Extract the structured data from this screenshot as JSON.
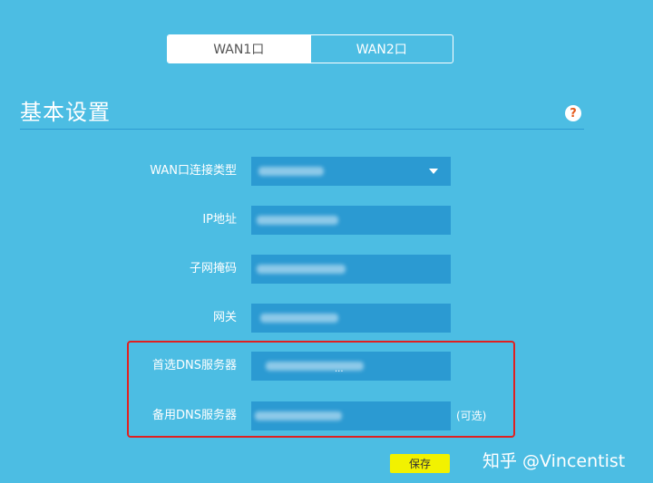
{
  "tabs": [
    {
      "label": "WAN1口",
      "active": true
    },
    {
      "label": "WAN2口",
      "active": false
    }
  ],
  "section": {
    "title": "基本设置",
    "help_icon": "question-mark-icon"
  },
  "form": {
    "wan_type": {
      "label": "WAN口连接类型"
    },
    "ip": {
      "label": "IP地址"
    },
    "subnet": {
      "label": "子网掩码"
    },
    "gateway": {
      "label": "网关"
    },
    "dns_primary": {
      "label": "首选DNS服务器",
      "dots": "..."
    },
    "dns_secondary": {
      "label": "备用DNS服务器",
      "optional": "(可选)"
    }
  },
  "save_label": "保存",
  "watermark": "知乎 @Vincentist",
  "colors": {
    "background": "#4cbde3",
    "field": "#2b9ad2",
    "highlight": "#e02020",
    "save_button": "#f2f200",
    "help_icon": "#e55a1c"
  }
}
